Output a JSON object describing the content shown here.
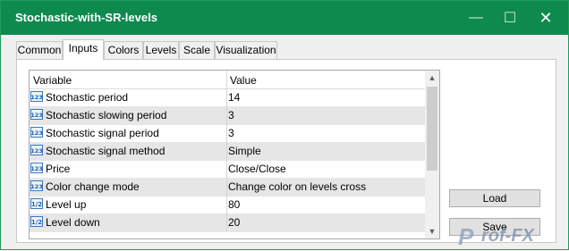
{
  "window": {
    "title": "Stochastic-with-SR-levels"
  },
  "titlebar_buttons": {
    "minimize": "—",
    "maximize": "☐",
    "close": "✕"
  },
  "tabs": [
    "Common",
    "Inputs",
    "Colors",
    "Levels",
    "Scale",
    "Visualization"
  ],
  "active_tab": "Inputs",
  "grid": {
    "headers": {
      "variable": "Variable",
      "value": "Value"
    },
    "rows": [
      {
        "icon": "123",
        "variable": "Stochastic period",
        "value": "14"
      },
      {
        "icon": "123",
        "variable": "Stochastic slowing period",
        "value": "3"
      },
      {
        "icon": "123",
        "variable": "Stochastic signal period",
        "value": "3"
      },
      {
        "icon": "123",
        "variable": "Stochastic signal method",
        "value": "Simple"
      },
      {
        "icon": "123",
        "variable": "Price",
        "value": "Close/Close"
      },
      {
        "icon": "123",
        "variable": "Color change mode",
        "value": "Change color on levels cross"
      },
      {
        "icon": "1/2",
        "variable": "Level up",
        "value": "80"
      },
      {
        "icon": "1/2",
        "variable": "Level down",
        "value": "20"
      }
    ],
    "scrollbar": {
      "up": "▲",
      "down": "▼"
    }
  },
  "buttons": {
    "load": "Load",
    "save": "Save"
  },
  "watermark": {
    "p": "P",
    "text": "rof-FX"
  }
}
